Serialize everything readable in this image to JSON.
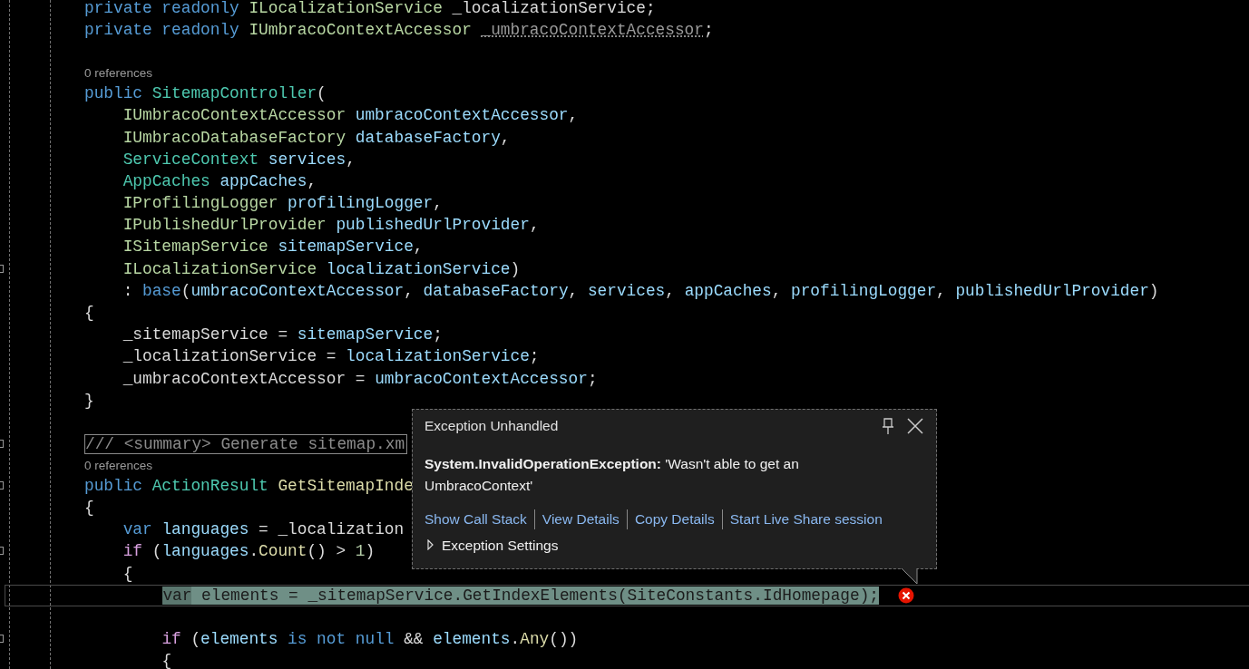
{
  "editor": {
    "lines": [
      {
        "kind": "code",
        "current": false,
        "error": false,
        "fold": false,
        "tokens": [
          {
            "kind": "kw",
            "text": "private readonly "
          },
          {
            "kind": "type",
            "text": "ILocalizationService"
          },
          {
            "kind": "plain",
            "text": " _localizationService;"
          }
        ]
      },
      {
        "kind": "code",
        "current": false,
        "error": false,
        "fold": false,
        "tokens": [
          {
            "kind": "kw",
            "text": "private readonly "
          },
          {
            "kind": "type",
            "text": "IUmbracoContextAccessor "
          },
          {
            "kind": "unused",
            "text": "_umbracoContextAccessor"
          },
          {
            "kind": "plain",
            "text": ";"
          }
        ]
      },
      {
        "kind": "blank"
      },
      {
        "kind": "codelens",
        "text": "0 references"
      },
      {
        "kind": "code",
        "current": false,
        "error": false,
        "fold": false,
        "tokens": [
          {
            "kind": "kw",
            "text": "public "
          },
          {
            "kind": "cls",
            "text": "SitemapController"
          },
          {
            "kind": "plain",
            "text": "("
          }
        ]
      },
      {
        "kind": "code",
        "current": false,
        "error": false,
        "fold": false,
        "tokens": [
          {
            "kind": "type",
            "text": "    IUmbracoContextAccessor"
          },
          {
            "kind": "param",
            "text": " umbracoContextAccessor"
          },
          {
            "kind": "plain",
            "text": ","
          }
        ]
      },
      {
        "kind": "code",
        "current": false,
        "error": false,
        "fold": false,
        "tokens": [
          {
            "kind": "type",
            "text": "    IUmbracoDatabaseFactory"
          },
          {
            "kind": "param",
            "text": " databaseFactory"
          },
          {
            "kind": "plain",
            "text": ","
          }
        ]
      },
      {
        "kind": "code",
        "current": false,
        "error": false,
        "fold": false,
        "tokens": [
          {
            "kind": "cls",
            "text": "    ServiceContext"
          },
          {
            "kind": "param",
            "text": " services"
          },
          {
            "kind": "plain",
            "text": ","
          }
        ]
      },
      {
        "kind": "code",
        "current": false,
        "error": false,
        "fold": false,
        "tokens": [
          {
            "kind": "cls",
            "text": "    AppCaches"
          },
          {
            "kind": "param",
            "text": " appCaches"
          },
          {
            "kind": "plain",
            "text": ","
          }
        ]
      },
      {
        "kind": "code",
        "current": false,
        "error": false,
        "fold": false,
        "tokens": [
          {
            "kind": "type",
            "text": "    IProfilingLogger"
          },
          {
            "kind": "param",
            "text": " profilingLogger"
          },
          {
            "kind": "plain",
            "text": ","
          }
        ]
      },
      {
        "kind": "code",
        "current": false,
        "error": false,
        "fold": false,
        "tokens": [
          {
            "kind": "type",
            "text": "    IPublishedUrlProvider"
          },
          {
            "kind": "param",
            "text": " publishedUrlProvider"
          },
          {
            "kind": "plain",
            "text": ","
          }
        ]
      },
      {
        "kind": "code",
        "current": false,
        "error": false,
        "fold": false,
        "tokens": [
          {
            "kind": "type",
            "text": "    ISitemapService"
          },
          {
            "kind": "param",
            "text": " sitemapService"
          },
          {
            "kind": "plain",
            "text": ","
          }
        ]
      },
      {
        "kind": "code",
        "current": false,
        "error": false,
        "fold": true,
        "tokens": [
          {
            "kind": "type",
            "text": "    ILocalizationService"
          },
          {
            "kind": "param",
            "text": " localizationService"
          },
          {
            "kind": "plain",
            "text": ")"
          }
        ]
      },
      {
        "kind": "code",
        "current": false,
        "error": false,
        "fold": false,
        "tokens": [
          {
            "kind": "plain",
            "text": "    : "
          },
          {
            "kind": "kw",
            "text": "base"
          },
          {
            "kind": "plain",
            "text": "("
          },
          {
            "kind": "param",
            "text": "umbracoContextAccessor"
          },
          {
            "kind": "plain",
            "text": ", "
          },
          {
            "kind": "param",
            "text": "databaseFactory"
          },
          {
            "kind": "plain",
            "text": ", "
          },
          {
            "kind": "param",
            "text": "services"
          },
          {
            "kind": "plain",
            "text": ", "
          },
          {
            "kind": "param",
            "text": "appCaches"
          },
          {
            "kind": "plain",
            "text": ", "
          },
          {
            "kind": "param",
            "text": "profilingLogger"
          },
          {
            "kind": "plain",
            "text": ", "
          },
          {
            "kind": "param",
            "text": "publishedUrlProvider"
          },
          {
            "kind": "plain",
            "text": ")"
          }
        ]
      },
      {
        "kind": "code",
        "current": false,
        "error": false,
        "fold": false,
        "tokens": [
          {
            "kind": "plain",
            "text": "{"
          }
        ]
      },
      {
        "kind": "code",
        "current": false,
        "error": false,
        "fold": false,
        "tokens": [
          {
            "kind": "plain",
            "text": "    _sitemapService = "
          },
          {
            "kind": "param",
            "text": "sitemapService"
          },
          {
            "kind": "plain",
            "text": ";"
          }
        ]
      },
      {
        "kind": "code",
        "current": false,
        "error": false,
        "fold": false,
        "tokens": [
          {
            "kind": "plain",
            "text": "    _localizationService = "
          },
          {
            "kind": "param",
            "text": "localizationService"
          },
          {
            "kind": "plain",
            "text": ";"
          }
        ]
      },
      {
        "kind": "code",
        "current": false,
        "error": false,
        "fold": false,
        "tokens": [
          {
            "kind": "plain",
            "text": "    _umbracoContextAccessor = "
          },
          {
            "kind": "param",
            "text": "umbracoContextAccessor"
          },
          {
            "kind": "plain",
            "text": ";"
          }
        ]
      },
      {
        "kind": "code",
        "current": false,
        "error": false,
        "fold": false,
        "tokens": [
          {
            "kind": "plain",
            "text": "}"
          }
        ]
      },
      {
        "kind": "blank"
      },
      {
        "kind": "collapsed",
        "text": "/// <summary> Generate sitemap.xm",
        "fold": true
      },
      {
        "kind": "codelens",
        "text": "0 references"
      },
      {
        "kind": "code",
        "current": false,
        "error": false,
        "fold": true,
        "tokens": [
          {
            "kind": "kw",
            "text": "public "
          },
          {
            "kind": "cls",
            "text": "ActionResult"
          },
          {
            "kind": "method",
            "text": " GetSitemapInde"
          }
        ]
      },
      {
        "kind": "code",
        "current": false,
        "error": false,
        "fold": false,
        "tokens": [
          {
            "kind": "plain",
            "text": "{"
          }
        ]
      },
      {
        "kind": "code",
        "current": false,
        "error": false,
        "fold": false,
        "tokens": [
          {
            "kind": "kw",
            "text": "    var "
          },
          {
            "kind": "param",
            "text": "languages"
          },
          {
            "kind": "plain",
            "text": " = _localization"
          }
        ]
      },
      {
        "kind": "code",
        "current": false,
        "error": false,
        "fold": true,
        "tokens": [
          {
            "kind": "ctrl",
            "text": "    if"
          },
          {
            "kind": "plain",
            "text": " ("
          },
          {
            "kind": "param",
            "text": "languages"
          },
          {
            "kind": "plain",
            "text": "."
          },
          {
            "kind": "method",
            "text": "Count"
          },
          {
            "kind": "plain",
            "text": "() > "
          },
          {
            "kind": "num",
            "text": "1"
          },
          {
            "kind": "plain",
            "text": ")"
          }
        ]
      },
      {
        "kind": "code",
        "current": false,
        "error": false,
        "fold": false,
        "tokens": [
          {
            "kind": "plain",
            "text": "    {"
          }
        ]
      },
      {
        "kind": "code",
        "current": true,
        "error": true,
        "fold": false,
        "tokens": [
          {
            "kind": "kw",
            "text": "        var"
          },
          {
            "kind": "plain",
            "text": " elements = _sitemapService."
          },
          {
            "kind": "method",
            "text": "GetIndexElements"
          },
          {
            "kind": "plain",
            "text": "("
          },
          {
            "kind": "cls",
            "text": "SiteConstants"
          },
          {
            "kind": "plain",
            "text": ".IdHomepage);"
          }
        ]
      },
      {
        "kind": "blank"
      },
      {
        "kind": "code",
        "current": false,
        "error": false,
        "fold": true,
        "tokens": [
          {
            "kind": "ctrl",
            "text": "        if"
          },
          {
            "kind": "plain",
            "text": " ("
          },
          {
            "kind": "param",
            "text": "elements"
          },
          {
            "kind": "kw",
            "text": " is not null"
          },
          {
            "kind": "plain",
            "text": " && "
          },
          {
            "kind": "param",
            "text": "elements"
          },
          {
            "kind": "plain",
            "text": "."
          },
          {
            "kind": "method",
            "text": "Any"
          },
          {
            "kind": "plain",
            "text": "())"
          }
        ]
      },
      {
        "kind": "code",
        "current": false,
        "error": false,
        "fold": false,
        "tokens": [
          {
            "kind": "plain",
            "text": "        {"
          }
        ]
      }
    ]
  },
  "exception_popup": {
    "title": "Exception Unhandled",
    "message": "**System.InvalidOperationException:** 'Wasn't able to get an UmbracoContext'",
    "links": [
      "Show Call Stack",
      "View Details",
      "Copy Details",
      "Start Live Share session"
    ],
    "settings": {
      "label": "Exception Settings",
      "expanded": false
    }
  }
}
